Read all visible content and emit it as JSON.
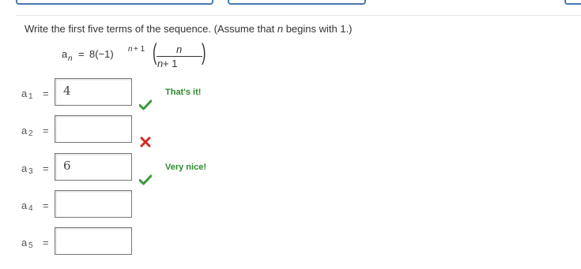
{
  "prompt": {
    "part1": "Write the first five terms of the sequence. (Assume that ",
    "var": "n",
    "part2": " begins with 1.)"
  },
  "formula": {
    "lhs_letter": "a",
    "lhs_sub": "n",
    "equals": "=",
    "coefficient": "8(−1)",
    "exponent_var": "n",
    "exponent_rest": " + 1",
    "numerator": "n",
    "denominator_var": "n",
    "denominator_rest": " + 1"
  },
  "rows": [
    {
      "letter": "a",
      "index": "1",
      "equals": "=",
      "value": "4",
      "status": "correct",
      "feedback": "That's it!"
    },
    {
      "letter": "a",
      "index": "2",
      "equals": "=",
      "value": "",
      "status": "incorrect",
      "feedback": ""
    },
    {
      "letter": "a",
      "index": "3",
      "equals": "=",
      "value": "6",
      "status": "correct",
      "feedback": "Very nice!"
    },
    {
      "letter": "a",
      "index": "4",
      "equals": "=",
      "value": "",
      "status": "none",
      "feedback": ""
    },
    {
      "letter": "a",
      "index": "5",
      "equals": "=",
      "value": "",
      "status": "none",
      "feedback": ""
    }
  ],
  "colors": {
    "correct": "#3a9a3a",
    "incorrect": "#d42a2a",
    "feedback_text": "#2e8b2e",
    "top_button_border": "#4a78b0"
  },
  "icons": {
    "correct": "check-icon",
    "incorrect": "x-mark-icon"
  }
}
